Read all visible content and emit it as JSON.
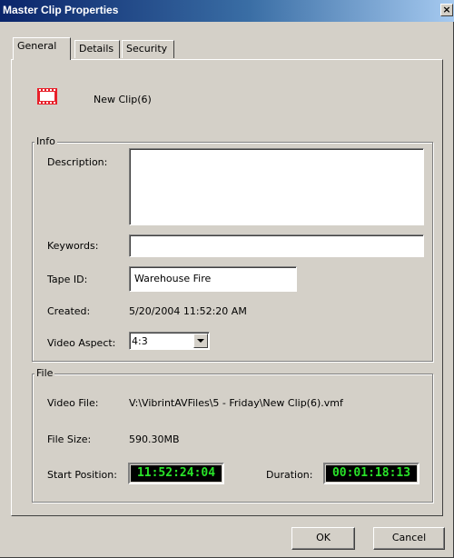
{
  "window": {
    "title": "Master Clip Properties",
    "close_glyph": "×"
  },
  "tabs": [
    {
      "label": "General",
      "active": true
    },
    {
      "label": "Details",
      "active": false
    },
    {
      "label": "Security",
      "active": false
    }
  ],
  "clip": {
    "name": "New Clip(6)",
    "icon": "film-clip-icon"
  },
  "info": {
    "legend": "Info",
    "description_label": "Description:",
    "description_value": "",
    "keywords_label": "Keywords:",
    "keywords_value": "",
    "tape_id_label": "Tape ID:",
    "tape_id_value": "Warehouse Fire",
    "created_label": "Created:",
    "created_value": "5/20/2004 11:52:20 AM",
    "aspect_label": "Video Aspect:",
    "aspect_value": "4:3"
  },
  "file": {
    "legend": "File",
    "video_file_label": "Video File:",
    "video_file_value": "V:\\VibrintAVFiles\\5 - Friday\\New Clip(6).vmf",
    "size_label": "File Size:",
    "size_value": "590.30MB",
    "start_label": "Start Position:",
    "start_value": "11:52:24:04",
    "duration_label": "Duration:",
    "duration_value": "00:01:18:13"
  },
  "buttons": {
    "ok": "OK",
    "cancel": "Cancel"
  },
  "colors": {
    "titlebar": "#0a246a",
    "timecode_text": "#29e329",
    "clip_icon": "#e8202a"
  }
}
